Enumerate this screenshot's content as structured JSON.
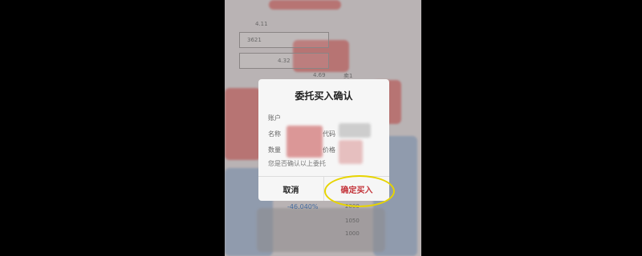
{
  "background": {
    "rows": [
      {
        "key": "r1",
        "text": "4.11"
      },
      {
        "key": "r2",
        "text": "3621"
      },
      {
        "key": "r3",
        "text": "4.32"
      },
      {
        "key": "r4",
        "text": "4.69"
      },
      {
        "key": "r5",
        "text": "卖1"
      },
      {
        "key": "r6",
        "text": "-46.040%"
      },
      {
        "key": "r7",
        "text": "2000"
      },
      {
        "key": "r8",
        "text": "1050"
      },
      {
        "key": "r9",
        "text": "1000"
      }
    ]
  },
  "dialog": {
    "title": "委托买入确认",
    "fields": {
      "account": "账户",
      "name": "名称",
      "code": "代码",
      "quantity": "数量",
      "price": "价格"
    },
    "hint": "您是否确认以上委托",
    "buttons": {
      "cancel": "取消",
      "confirm": "确定买入"
    }
  },
  "colors": {
    "confirm": "#c4343a",
    "highlight_circle": "#e7d400"
  }
}
